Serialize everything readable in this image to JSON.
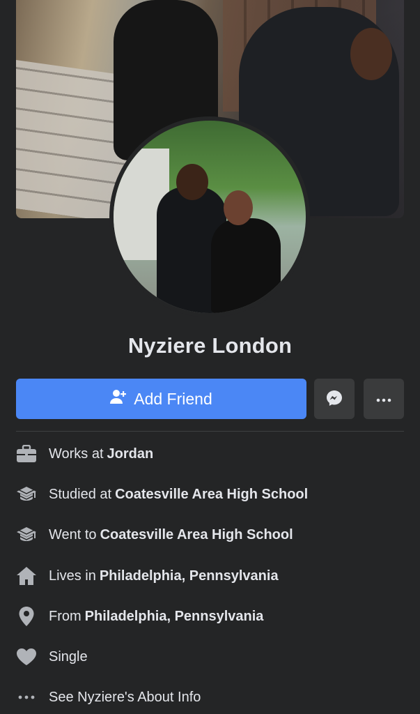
{
  "profile": {
    "name": "Nyziere London"
  },
  "actions": {
    "add_friend_label": "Add Friend",
    "messenger_icon": "messenger-icon",
    "more_icon": "more-dots-icon",
    "primary_color": "#4b87f5"
  },
  "intro": [
    {
      "prefix": "Works at",
      "value": "Jordan",
      "icon": "briefcase-icon"
    },
    {
      "prefix": "Studied at",
      "value": "Coatesville Area High School",
      "icon": "graduation-cap-icon"
    },
    {
      "prefix": "Went to",
      "value": "Coatesville Area High School",
      "icon": "graduation-cap-icon"
    },
    {
      "prefix": "Lives in",
      "value": "Philadelphia, Pennsylvania",
      "icon": "home-icon"
    },
    {
      "prefix": "From",
      "value": "Philadelphia, Pennsylvania",
      "icon": "location-pin-icon"
    },
    {
      "prefix": "Single",
      "value": "",
      "icon": "heart-icon"
    },
    {
      "prefix": "See Nyziere's About Info",
      "value": "",
      "icon": "more-dots-icon"
    }
  ]
}
